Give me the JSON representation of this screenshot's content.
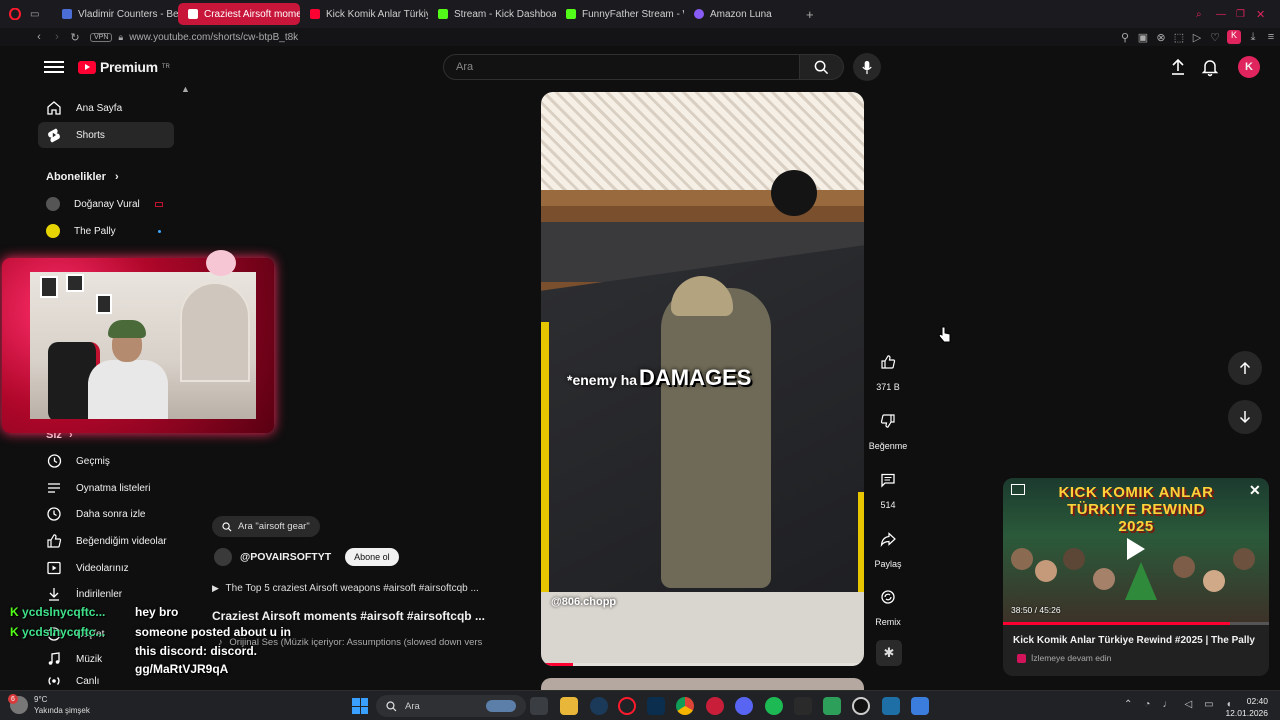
{
  "browser": {
    "tabs": [
      {
        "label": "Vladimir Counters - Best R",
        "color": "#4a6dd8"
      },
      {
        "label": "Craziest Airsoft mome",
        "color": "#ff0033",
        "active": true
      },
      {
        "label": "Kick Komik Anlar Türkiye R",
        "color": "#ff0033"
      },
      {
        "label": "Stream - Kick Dashboard",
        "color": "#53fc18"
      },
      {
        "label": "FunnyFather Stream - Wa",
        "color": "#53fc18"
      },
      {
        "label": "Amazon Luna",
        "color": "#8a5cf6"
      }
    ],
    "vpn_label": "VPN",
    "url": "www.youtube.com/shorts/cw-btpB_t8k",
    "profile_letter": "K"
  },
  "header": {
    "brand": "Premium",
    "region": "TR",
    "search_placeholder": "Ara",
    "avatar_letter": "K"
  },
  "sidebar": {
    "primary": [
      {
        "label": "Ana Sayfa",
        "icon": "home-icon"
      },
      {
        "label": "Shorts",
        "icon": "shorts-icon",
        "active": true
      }
    ],
    "subscriptions_title": "Abonelikler",
    "subscriptions": [
      {
        "label": "Doğanay Vural",
        "color": "#555555"
      },
      {
        "label": "The Pally",
        "color": "#e6d400"
      }
    ],
    "you_title": "Siz",
    "you_items": [
      {
        "label": "Geçmiş",
        "icon": "history-icon"
      },
      {
        "label": "Oynatma listeleri",
        "icon": "playlist-icon"
      },
      {
        "label": "Daha sonra izle",
        "icon": "clock-icon"
      },
      {
        "label": "Beğendiğim videolar",
        "icon": "thumb-up-icon"
      },
      {
        "label": "Videolarınız",
        "icon": "video-icon"
      },
      {
        "label": "İndirilenler",
        "icon": "download-icon"
      },
      {
        "label": "Keşfet",
        "icon": "explore-icon"
      },
      {
        "label": "Müzik",
        "icon": "music-icon"
      },
      {
        "label": "Canlı",
        "icon": "live-icon"
      }
    ]
  },
  "chat": {
    "user1": "ycdslnycqftc...",
    "user2": "ycdslnycqftc...",
    "message_lines": [
      "hey bro",
      "someone posted about u in",
      "this discord: discord.",
      "gg/MaRtVJR9qA"
    ]
  },
  "short": {
    "related_search": "Ara \"airsoft gear\"",
    "channel": "@POVAIRSOFTYT",
    "subscribe_label": "Abone ol",
    "playlist": "The Top 5 craziest Airsoft weapons #airsoft #airsoftcqb ...",
    "title": "Craziest Airsoft moments #airsoft #airsoftcqb ...",
    "music": "Orijinal Ses (Müzik içeriyor: Assumptions (slowed down vers",
    "caption_small": "*enemy ha",
    "caption_big": "DAMAGES",
    "watermark": "@806.chopp",
    "progress": 0.1
  },
  "actions": {
    "likes": "371 B",
    "dislike_label": "Beğenme",
    "comments": "514",
    "share_label": "Paylaş",
    "remix_label": "Remix"
  },
  "miniplayer": {
    "art_line1": "KICK KOMIK ANLAR",
    "art_line2": "TÜRKIYE REWIND",
    "art_line3": "2025",
    "time": "38:50 / 45:26",
    "progress": 0.855,
    "title": "Kick Komik Anlar Türkiye Rewind #2025 | The Pally",
    "subtitle": "İzlemeye devam edin"
  },
  "taskbar": {
    "notification_count": "6",
    "temperature": "9°C",
    "weather": "Yakında şimşek",
    "search_placeholder": "Ara",
    "time": "02:40",
    "date": "12.01.2026"
  }
}
